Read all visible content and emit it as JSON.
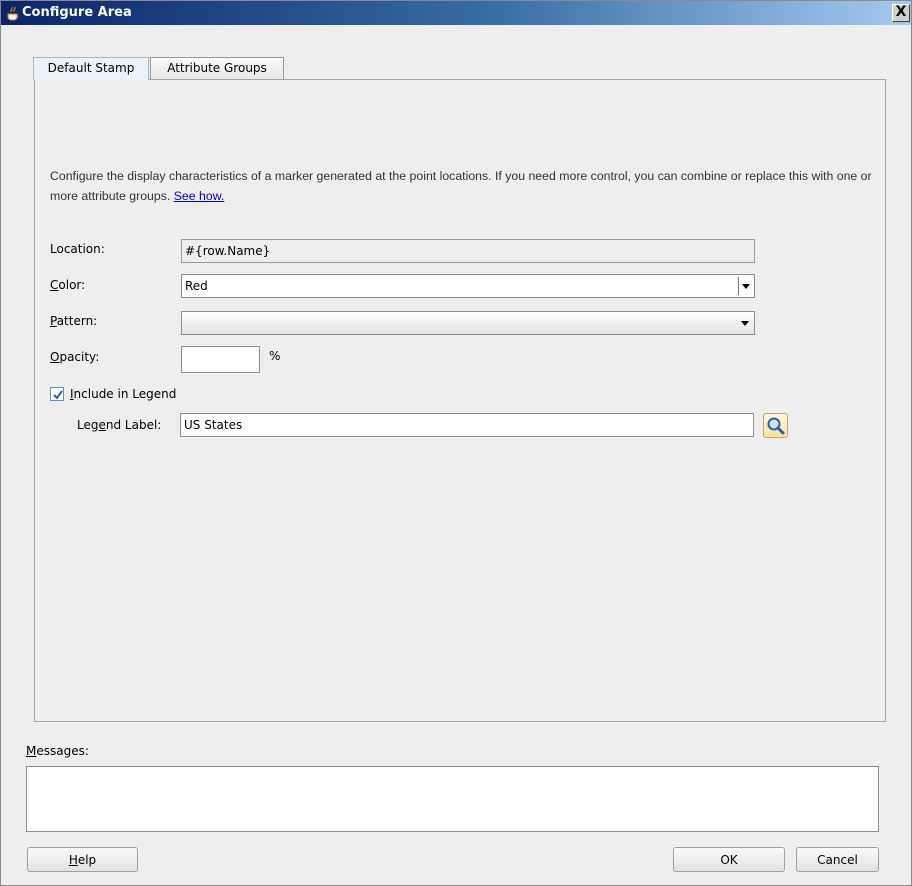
{
  "window": {
    "title": "Configure Area",
    "close_glyph": "X"
  },
  "tabs": [
    {
      "label": "Default Stamp",
      "active": true
    },
    {
      "label": "Attribute Groups",
      "active": false
    }
  ],
  "description": {
    "text": "Configure the display characteristics of a marker generated at the point locations. If you need more control, you can combine or replace this with one or more attribute groups.",
    "link": "See how."
  },
  "form": {
    "location": {
      "label": "Location:",
      "value": "#{row.Name}"
    },
    "color": {
      "label_mnemonic": "C",
      "label_rest": "olor:",
      "value": "Red"
    },
    "pattern": {
      "label_mnemonic": "P",
      "label_rest": "attern:",
      "value": ""
    },
    "opacity": {
      "label_mnemonic": "O",
      "label_rest": "pacity:",
      "value": "",
      "unit": "%"
    },
    "include_in_legend": {
      "label_mnemonic": "I",
      "label_rest": "nclude in Legend",
      "checked": true
    },
    "legend_label": {
      "label_pre": "Leg",
      "label_mnemonic": "e",
      "label_post": "nd Label:",
      "value": "US States"
    }
  },
  "messages": {
    "label_mnemonic": "M",
    "label_rest": "essages:",
    "content": ""
  },
  "buttons": {
    "help_mnemonic": "H",
    "help_rest": "elp",
    "ok": "OK",
    "cancel": "Cancel"
  },
  "icons": {
    "app": "java-coffee-cup-icon",
    "search": "magnifier-icon",
    "check": "checkmark-icon"
  }
}
